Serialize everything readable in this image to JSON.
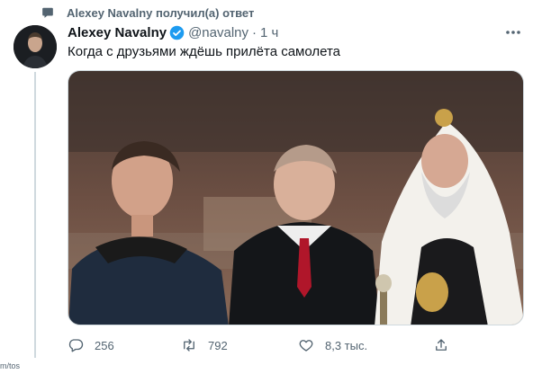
{
  "context": {
    "text": "Alexey Navalny получил(а) ответ",
    "icon": "speech-bubble-icon"
  },
  "tweet": {
    "name": "Alexey Navalny",
    "handle": "@navalny",
    "separator": "·",
    "time": "1 ч",
    "verified_icon": "verified-badge-icon",
    "more_icon": "more-dots-icon",
    "text": "Когда с друзьями ждёшь прилёта самолета"
  },
  "actions": {
    "reply": {
      "icon": "reply-icon",
      "count": "256"
    },
    "retweet": {
      "icon": "retweet-icon",
      "count": "792"
    },
    "like": {
      "icon": "like-icon",
      "count": "8,3 тыс."
    },
    "share": {
      "icon": "share-icon"
    }
  },
  "sidebar_fragment": {
    "text": "m/tos"
  },
  "colors": {
    "accent": "#1d9bf0",
    "text": "#0f1419",
    "secondary": "#536471",
    "border": "#cfd9de"
  }
}
